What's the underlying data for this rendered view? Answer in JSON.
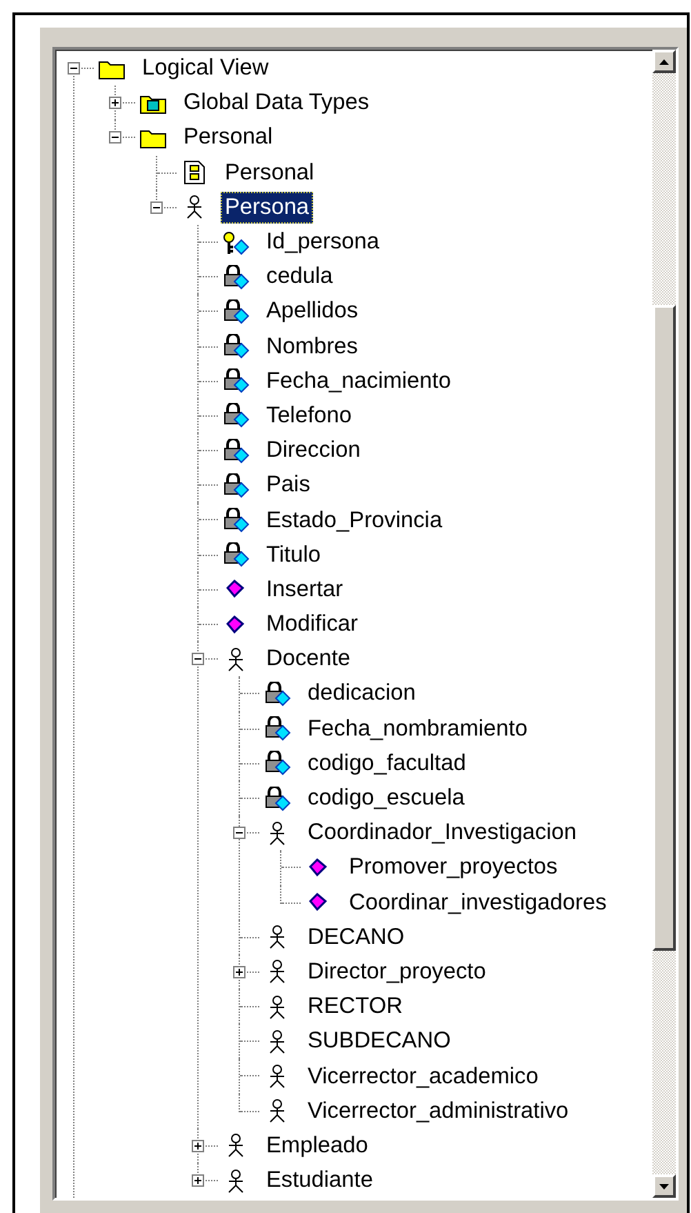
{
  "tree": [
    {
      "label": "Logical View",
      "kind": "folder",
      "selected": false,
      "expanded": true,
      "children": [
        {
          "label": "Global Data Types",
          "kind": "package",
          "selected": false,
          "expanded": false
        },
        {
          "label": "Personal",
          "kind": "folder",
          "selected": false,
          "expanded": true,
          "children": [
            {
              "label": "Personal",
              "kind": "diagram",
              "selected": false
            },
            {
              "label": "Persona",
              "kind": "class",
              "selected": true,
              "expanded": true,
              "children": [
                {
                  "label": "Id_persona",
                  "kind": "key_attribute",
                  "selected": false
                },
                {
                  "label": "cedula",
                  "kind": "attribute",
                  "selected": false
                },
                {
                  "label": "Apellidos",
                  "kind": "attribute",
                  "selected": false
                },
                {
                  "label": "Nombres",
                  "kind": "attribute",
                  "selected": false
                },
                {
                  "label": "Fecha_nacimiento",
                  "kind": "attribute",
                  "selected": false
                },
                {
                  "label": "Telefono",
                  "kind": "attribute",
                  "selected": false
                },
                {
                  "label": "Direccion",
                  "kind": "attribute",
                  "selected": false
                },
                {
                  "label": "Pais",
                  "kind": "attribute",
                  "selected": false
                },
                {
                  "label": "Estado_Provincia",
                  "kind": "attribute",
                  "selected": false
                },
                {
                  "label": "Titulo",
                  "kind": "attribute",
                  "selected": false
                },
                {
                  "label": "Insertar",
                  "kind": "operation",
                  "selected": false
                },
                {
                  "label": "Modificar",
                  "kind": "operation",
                  "selected": false
                },
                {
                  "label": "Docente",
                  "kind": "class",
                  "selected": false,
                  "expanded": true,
                  "children": [
                    {
                      "label": "dedicacion",
                      "kind": "attribute",
                      "selected": false
                    },
                    {
                      "label": "Fecha_nombramiento",
                      "kind": "attribute",
                      "selected": false
                    },
                    {
                      "label": "codigo_facultad",
                      "kind": "attribute",
                      "selected": false
                    },
                    {
                      "label": "codigo_escuela",
                      "kind": "attribute",
                      "selected": false
                    },
                    {
                      "label": "Coordinador_Investigacion",
                      "kind": "class",
                      "selected": false,
                      "expanded": true,
                      "children": [
                        {
                          "label": "Promover_proyectos",
                          "kind": "operation",
                          "selected": false
                        },
                        {
                          "label": "Coordinar_investigadores",
                          "kind": "operation",
                          "selected": false
                        }
                      ]
                    },
                    {
                      "label": "DECANO",
                      "kind": "class",
                      "selected": false
                    },
                    {
                      "label": "Director_proyecto",
                      "kind": "class",
                      "selected": false,
                      "expanded": false
                    },
                    {
                      "label": "RECTOR",
                      "kind": "class",
                      "selected": false
                    },
                    {
                      "label": "SUBDECANO",
                      "kind": "class",
                      "selected": false
                    },
                    {
                      "label": "Vicerrector_academico",
                      "kind": "class",
                      "selected": false
                    },
                    {
                      "label": "Vicerrector_administrativo",
                      "kind": "class",
                      "selected": false
                    }
                  ]
                },
                {
                  "label": "Empleado",
                  "kind": "class",
                  "selected": false,
                  "expanded": false
                },
                {
                  "label": "Estudiante",
                  "kind": "class",
                  "selected": false,
                  "expanded": false
                }
              ]
            }
          ]
        }
      ]
    }
  ]
}
